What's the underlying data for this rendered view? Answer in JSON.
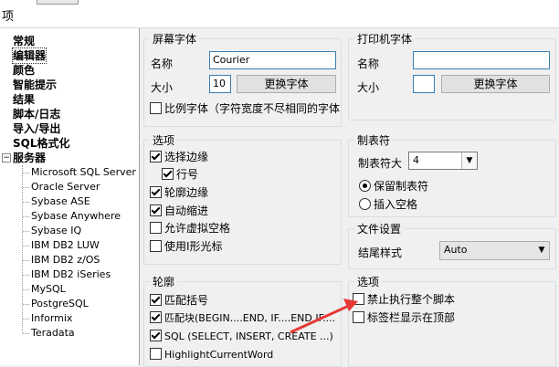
{
  "window": {
    "title": "项"
  },
  "tree": {
    "items": [
      {
        "label": "常规"
      },
      {
        "label": "编辑器"
      },
      {
        "label": "颜色"
      },
      {
        "label": "智能提示"
      },
      {
        "label": "结果"
      },
      {
        "label": "脚本/日志"
      },
      {
        "label": "导入/导出"
      },
      {
        "label": "SQL格式化"
      },
      {
        "label": "服务器"
      }
    ],
    "servers": [
      "Microsoft SQL Server",
      "Oracle Server",
      "Sybase ASE",
      "Sybase Anywhere",
      "Sybase IQ",
      "IBM DB2 LUW",
      "IBM DB2 z/OS",
      "IBM DB2 iSeries",
      "MySQL",
      "PostgreSQL",
      "Informix",
      "Teradata"
    ]
  },
  "screen_font": {
    "legend": "屏幕字体",
    "name_label": "名称",
    "name_value": "Courier",
    "size_label": "大小",
    "size_value": "10",
    "change_button": "更换字体",
    "proportional_label": "比例字体（字符宽度不尽相同的字体",
    "proportional_checked": false
  },
  "printer_font": {
    "legend": "打印机字体",
    "name_label": "名称",
    "name_value": "",
    "size_label": "大小",
    "size_value": "",
    "change_button": "更换字体"
  },
  "options": {
    "legend": "选项",
    "items": [
      {
        "label": "选择边缘",
        "checked": true
      },
      {
        "label": "行号",
        "checked": true
      },
      {
        "label": "轮廓边缘",
        "checked": true
      },
      {
        "label": "自动缩进",
        "checked": true
      },
      {
        "label": "允许虚拟空格",
        "checked": false
      },
      {
        "label": "使用I形光标",
        "checked": false
      }
    ]
  },
  "tabs": {
    "legend": "制表符",
    "size_label": "制表符大",
    "size_value": "4",
    "keep_label": "保留制表符",
    "insert_label": "插入空格",
    "keep_selected": true
  },
  "file_settings": {
    "legend": "文件设置",
    "ending_label": "结尾样式",
    "ending_value": "Auto"
  },
  "outline": {
    "legend": "轮廓",
    "items": [
      {
        "label": "匹配括号",
        "checked": true
      },
      {
        "label": "匹配块(BEGIN....END, IF....END IF....",
        "checked": true
      },
      {
        "label": "SQL (SELECT, INSERT, CREATE ...)",
        "checked": true
      },
      {
        "label": "HighlightCurrentWord",
        "checked": false
      }
    ]
  },
  "options2": {
    "legend": "选项",
    "items": [
      {
        "label": "禁止执行整个脚本",
        "checked": false
      },
      {
        "label": "标签栏显示在顶部",
        "checked": false
      }
    ]
  },
  "colors": {
    "annotation_arrow": "#e53935",
    "tree_bg": "#ffffff",
    "panel_bg": "#f0f0f0"
  }
}
